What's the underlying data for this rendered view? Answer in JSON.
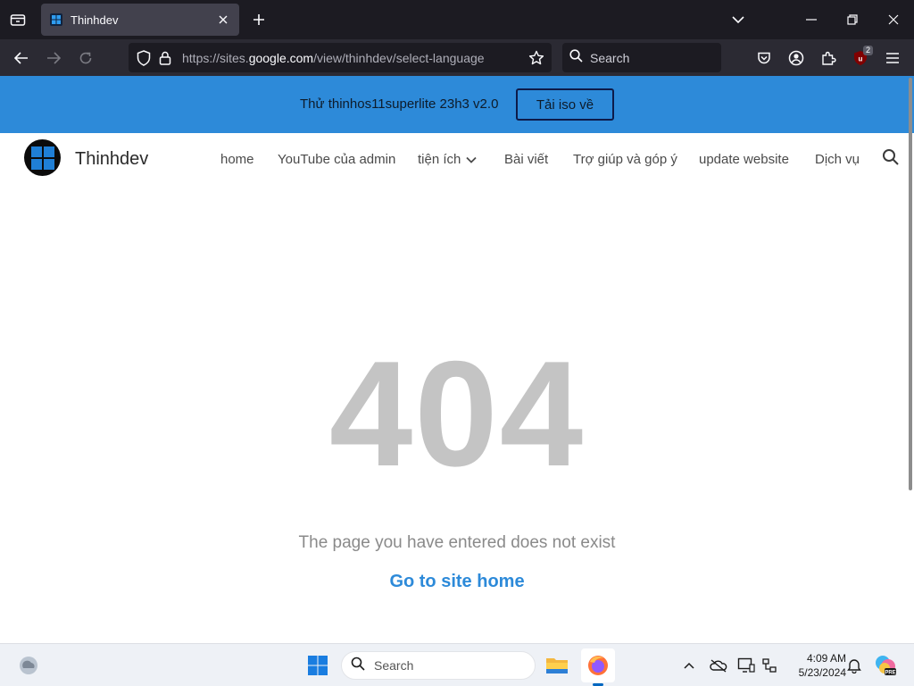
{
  "browser": {
    "tab_title": "Thinhdev",
    "url_prefix": "https://sites.",
    "url_host": "google.com",
    "url_path": "/view/thinhdev/select-language",
    "search_placeholder": "Search",
    "extension_badge": "2"
  },
  "banner": {
    "text": "Thử thinhos11superlite 23h3 v2.0",
    "button_label": "Tải iso về",
    "color": "#2d8ad9"
  },
  "site": {
    "title": "Thinhdev",
    "nav": {
      "home": "home",
      "youtube": "YouTube của admin",
      "tien_ich": "tiện ích",
      "bai_viet": "Bài viết",
      "tro_giup": "Trợ giúp và góp ý",
      "update": "update website",
      "dich_vu": "Dịch vụ"
    }
  },
  "error": {
    "code": "404",
    "message": "The page you have entered does not exist",
    "link": "Go to site home"
  },
  "taskbar": {
    "search_placeholder": "Search",
    "time": "4:09 AM",
    "date": "5/23/2024"
  }
}
